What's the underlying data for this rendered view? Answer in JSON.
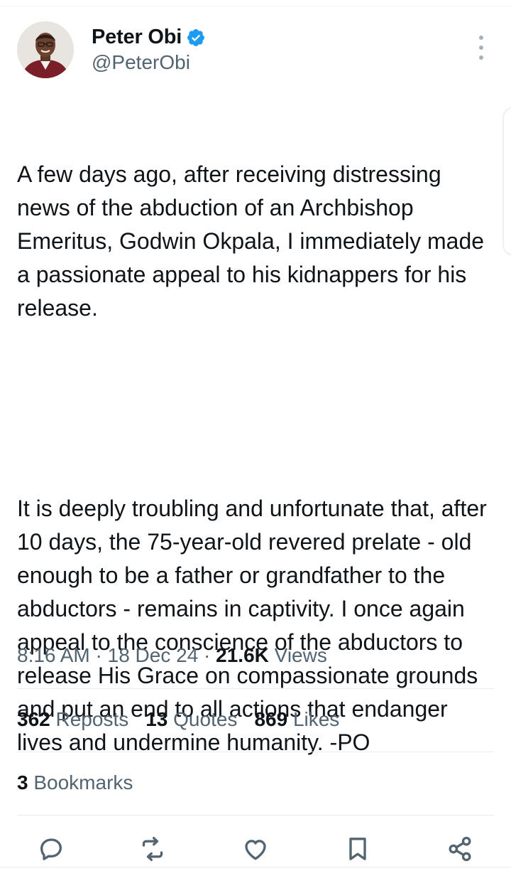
{
  "author": {
    "name": "Peter Obi",
    "handle": "@PeterObi",
    "verified_color": "#1d9bf0"
  },
  "tweet": {
    "paragraphs": [
      "A few days ago, after receiving distressing news of the abduction of an Archbishop Emeritus, Godwin Okpala, I immediately made a passionate appeal to his kidnappers for his release.",
      "It is deeply troubling and unfortunate that, after 10 days, the 75-year-old revered prelate - old enough to be a father or grandfather to the abductors - remains in captivity. I once again appeal to the conscience of the abductors to release His Grace on compassionate grounds and put an end to all actions that endanger lives and undermine humanity. -PO"
    ]
  },
  "meta": {
    "time": "8:16 AM",
    "separator": "·",
    "date": "18 Dec 24",
    "views_count": "21.6K",
    "views_label": "Views"
  },
  "stats": {
    "reposts_count": "362",
    "reposts_label": "Reposts",
    "quotes_count": "13",
    "quotes_label": "Quotes",
    "likes_count": "869",
    "likes_label": "Likes",
    "bookmarks_count": "3",
    "bookmarks_label": "Bookmarks"
  },
  "actions": {
    "icons": [
      "reply-icon",
      "repost-icon",
      "like-icon",
      "bookmark-icon",
      "share-icon"
    ],
    "icon_color": "#536471"
  }
}
